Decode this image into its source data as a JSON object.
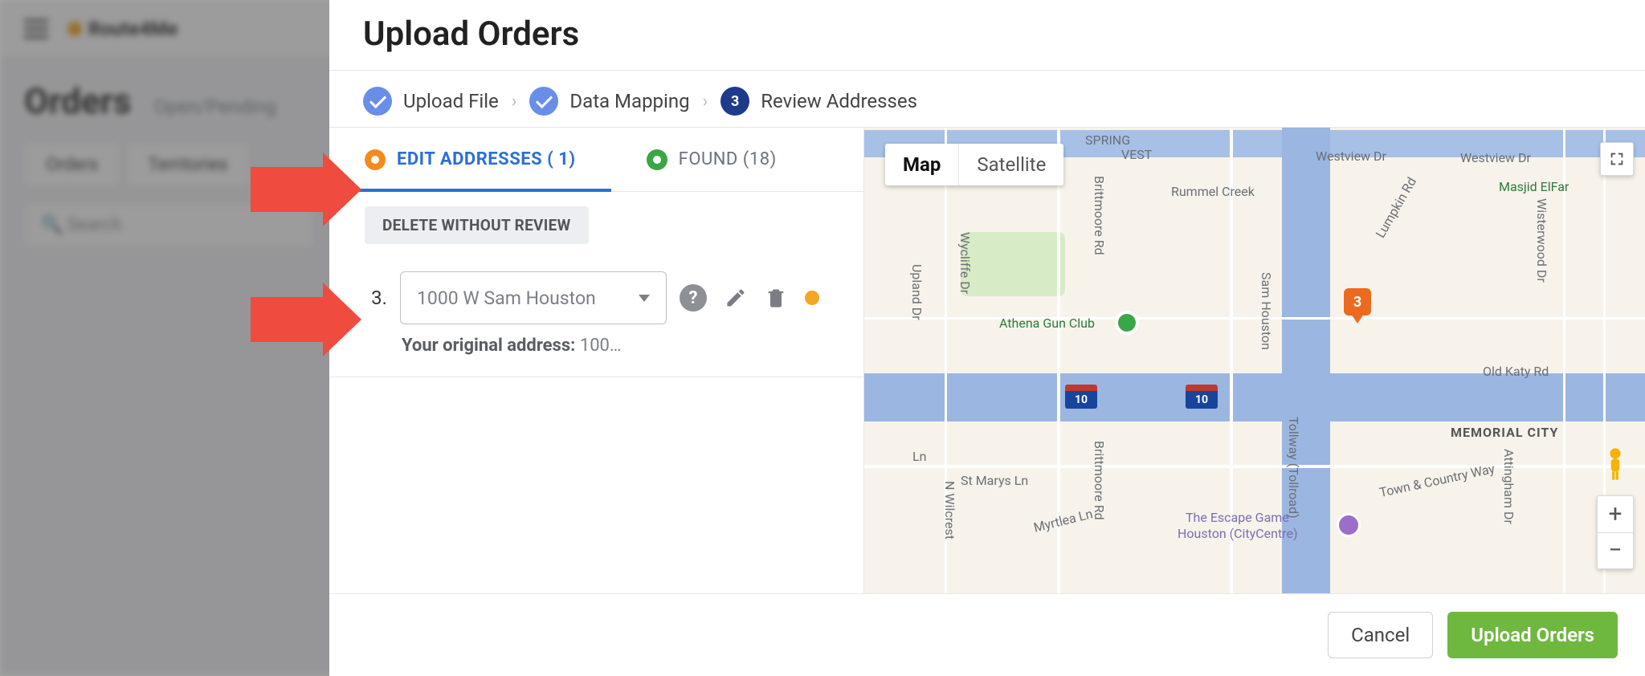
{
  "background": {
    "logo": "Route4Me",
    "page_title": "Orders",
    "page_subtitle": "Open/Pending",
    "tab_orders": "Orders",
    "tab_territories": "Territories",
    "search_placeholder": "Search"
  },
  "modal": {
    "title": "Upload Orders",
    "steps": {
      "upload": "Upload File",
      "mapping": "Data Mapping",
      "review_num": "3",
      "review": "Review Addresses"
    },
    "tabs": {
      "edit": "EDIT ADDRESSES ( 1)",
      "found": "FOUND (18)"
    },
    "delete_btn": "DELETE WITHOUT REVIEW",
    "row": {
      "index": "3.",
      "value": "1000 W Sam Houston",
      "orig_label": "Your original address:",
      "orig_value": "100…"
    },
    "footer": {
      "cancel": "Cancel",
      "upload": "Upload Orders"
    }
  },
  "map": {
    "type_map": "Map",
    "type_sat": "Satellite",
    "marker": "3",
    "shield": "10",
    "labels": {
      "spring": "SPRING",
      "vest": "VEST",
      "westview1": "Westview Dr",
      "westview2": "Westview Dr",
      "rummel": "Rummel Creek",
      "brittmoore1": "Brittmoore Rd",
      "brittmoore2": "Brittmoore Rd",
      "lumpkin": "Lumpkin Rd",
      "masjid": "Masjid ElFar",
      "wisterwood": "Wisterwood Dr",
      "athena": "Athena Gun Club",
      "wycliffe": "Wycliffe Dr",
      "upland": "Upland Dr",
      "ln": "Ln",
      "samtoll1": "Sam Houston",
      "samtoll2": "Tollway (Tollroad)",
      "oldkaty": "Old Katy Rd",
      "memcity": "MEMORIAL CITY",
      "attingham": "Attingham Dr",
      "towncountry": "Town & Country Way",
      "stmarys": "St Marys Ln",
      "myrtlea": "Myrtlea Ln",
      "wilcrest": "N Wilcrest",
      "escape1": "The Escape Game",
      "escape2": "Houston (CityCentre)"
    },
    "zoom_in": "+",
    "zoom_out": "−"
  }
}
